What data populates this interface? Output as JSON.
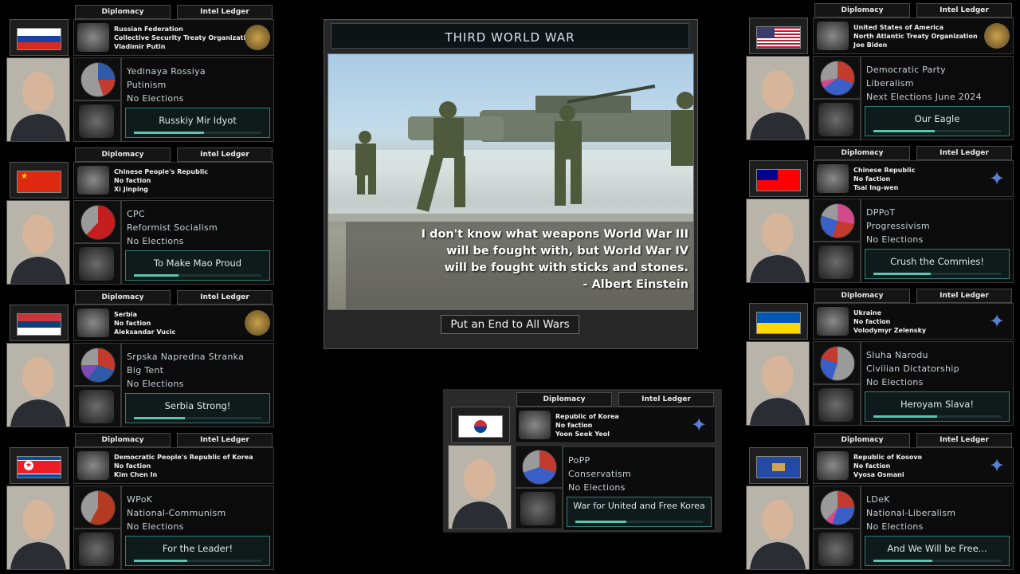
{
  "event": {
    "title": "THIRD WORLD WAR",
    "quote_lines": [
      "I don't know what weapons World War III",
      "will be fought with, but World War IV",
      "will be fought with sticks and stones.",
      "- Albert Einstein"
    ],
    "button": "Put an End to All Wars"
  },
  "colors": {
    "accent": "#58c6b0",
    "panel_bg": "#0b0b0b",
    "border": "#3a3a3a"
  },
  "panels": [
    {
      "id": "russia",
      "tab_diplomacy": "Diplomacy",
      "tab_intel": "Intel Ledger",
      "country": "Russian Federation",
      "faction": "Collective Security Treaty Organization",
      "leader": "Vladimir Putin",
      "party": "Yedinaya Rossiya",
      "ideology": "Putinism",
      "elections": "No Elections",
      "slogan": "Russkiy Mir Idyot",
      "flag_icon": "russia-flag",
      "pie": "conic-gradient(#2e5aa8 0 25%, #c23b2e 25% 45%, #9a9a9a 45% 100%)",
      "progress": 0.55
    },
    {
      "id": "china",
      "tab_diplomacy": "Diplomacy",
      "tab_intel": "Intel Ledger",
      "country": "Chinese People's Republic",
      "faction": "No faction",
      "leader": "Xi Jinping",
      "party": "CPC",
      "ideology": "Reformist Socialism",
      "elections": "No Elections",
      "slogan": "To Make Mao Proud",
      "flag_icon": "china-flag",
      "pie": "conic-gradient(#c41e1e 0 62%, #9a9a9a 62% 100%)",
      "progress": 0.35
    },
    {
      "id": "serbia",
      "tab_diplomacy": "Diplomacy",
      "tab_intel": "Intel Ledger",
      "country": "Serbia",
      "faction": "No faction",
      "leader": "Aleksandar Vucic",
      "party": "Srpska Napredna Stranka",
      "ideology": "Big Tent",
      "elections": "No Elections",
      "slogan": "Serbia Strong!",
      "flag_icon": "serbia-flag",
      "pie": "conic-gradient(#c23b2e 0 30%, #2e5aa8 30% 60%, #7e4ab8 60% 75%, #9a9a9a 75% 100%)",
      "progress": 0.4
    },
    {
      "id": "dprk",
      "tab_diplomacy": "Diplomacy",
      "tab_intel": "Intel Ledger",
      "country": "Democratic People's Republic of Korea",
      "faction": "No faction",
      "leader": "Kim Chen In",
      "party": "WPoK",
      "ideology": "National-Communism",
      "elections": "No Elections",
      "slogan": "For the Leader!",
      "flag_icon": "north-korea-flag",
      "pie": "conic-gradient(#b43a22 0 58%, #9a9a9a 58% 100%)",
      "progress": 0.42
    },
    {
      "id": "usa",
      "tab_diplomacy": "Diplomacy",
      "tab_intel": "Intel Ledger",
      "country": "United States of America",
      "faction": "North Atlantic Treaty Organization",
      "leader": "Joe Biden",
      "party": "Democratic Party",
      "ideology": "Liberalism",
      "elections": "Next Elections June 2024",
      "slogan": "Our Eagle",
      "flag_icon": "usa-flag",
      "pie": "conic-gradient(#c23b2e 0 30%, #3b5fc8 30% 65%, #d34a8a 65% 72%, #9a9a9a 72% 100%)",
      "progress": 0.48
    },
    {
      "id": "taiwan",
      "tab_diplomacy": "Diplomacy",
      "tab_intel": "Intel Ledger",
      "country": "Chinese Republic",
      "faction": "No faction",
      "leader": "Tsai Ing-wen",
      "party": "DPPoT",
      "ideology": "Progressivism",
      "elections": "No Elections",
      "slogan": "Crush the Commies!",
      "flag_icon": "taiwan-flag",
      "pie": "conic-gradient(#d34a8a 0 28%, #c23b2e 28% 55%, #3b5fc8 55% 80%, #9a9a9a 80% 100%)",
      "progress": 0.45
    },
    {
      "id": "ukraine",
      "tab_diplomacy": "Diplomacy",
      "tab_intel": "Intel Ledger",
      "country": "Ukraine",
      "faction": "No faction",
      "leader": "Volodymyr Zelensky",
      "party": "Sluha Narodu",
      "ideology": "Civilian Dictatorship",
      "elections": "No Elections",
      "slogan": "Heroyam Slava!",
      "flag_icon": "ukraine-flag",
      "pie": "conic-gradient(#9a9a9a 0 55%, #3b5fc8 55% 80%, #c23b2e 80% 100%)",
      "progress": 0.5
    },
    {
      "id": "kosovo",
      "tab_diplomacy": "Diplomacy",
      "tab_intel": "Intel Ledger",
      "country": "Republic of Kosovo",
      "faction": "No faction",
      "leader": "Vyosa Osmani",
      "party": "LDeK",
      "ideology": "National-Liberalism",
      "elections": "No Elections",
      "slogan": "And We Will be Free...",
      "flag_icon": "kosovo-flag",
      "pie": "conic-gradient(#c23b2e 0 25%, #3b5fc8 25% 55%, #d34a8a 55% 62%, #9a9a9a 62% 100%)",
      "progress": 0.46
    },
    {
      "id": "rok",
      "tab_diplomacy": "Diplomacy",
      "tab_intel": "Intel Ledger",
      "country": "Republic of Korea",
      "faction": "No faction",
      "leader": "Yoon Seok Yeol",
      "party": "PoPP",
      "ideology": "Conservatism",
      "elections": "No Elections",
      "slogan": "War for United and Free Korea",
      "flag_icon": "south-korea-flag",
      "pie": "conic-gradient(#c23b2e 0 30%, #3b5fc8 30% 70%, #9a9a9a 70% 100%)",
      "progress": 0.4
    }
  ]
}
